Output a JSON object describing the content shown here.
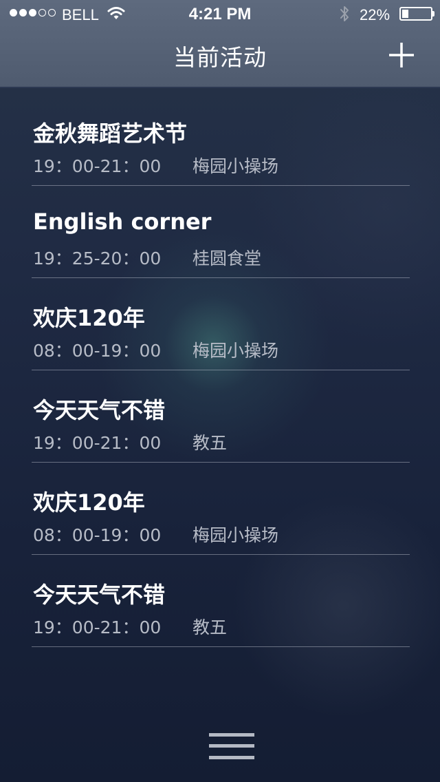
{
  "status_bar": {
    "signal_full": 3,
    "signal_total": 5,
    "carrier": "BELL",
    "time": "4:21 PM",
    "battery_percent": "22%",
    "battery_level": 0.22,
    "icons": [
      "signal-dots-icon",
      "wifi-icon",
      "bluetooth-icon",
      "battery-icon"
    ]
  },
  "nav": {
    "title": "当前活动",
    "add_icon": "plus-icon"
  },
  "activities": [
    {
      "title": "金秋舞蹈艺术节",
      "time": "19：00-21：00",
      "location": "梅园小操场"
    },
    {
      "title": "English corner",
      "time": "19：25-20：00",
      "location": "桂圆食堂"
    },
    {
      "title": "欢庆120年",
      "time": "08：00-19：00",
      "location": "梅园小操场"
    },
    {
      "title": "今天天气不错",
      "time": "19：00-21：00",
      "location": "教五"
    },
    {
      "title": "欢庆120年",
      "time": "08：00-19：00",
      "location": "梅园小操场"
    },
    {
      "title": "今天天气不错",
      "time": "19：00-21：00",
      "location": "教五"
    }
  ],
  "bottom": {
    "menu_icon": "hamburger-menu-icon"
  },
  "colors": {
    "nav_background": "#56627a",
    "page_background": "#1b2540",
    "title_text": "#ffffff",
    "meta_text": "#b7bcc7",
    "divider": "#8a909c"
  }
}
